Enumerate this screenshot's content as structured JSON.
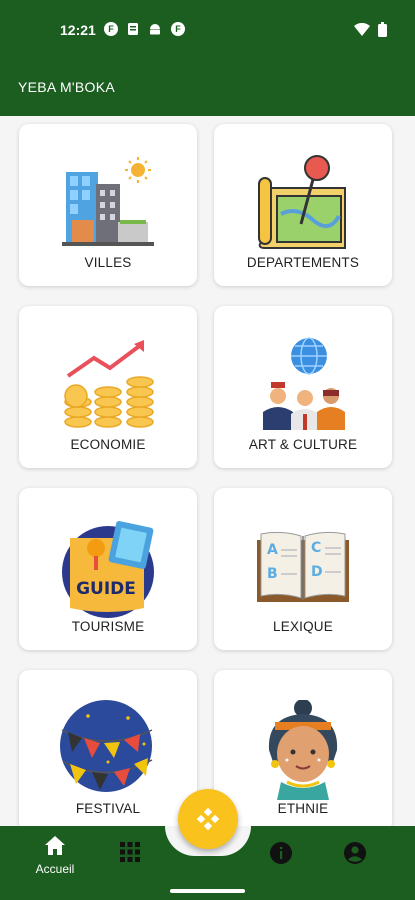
{
  "status_bar": {
    "time": "12:21",
    "notif_icons": [
      "f-circle-icon",
      "document-icon",
      "android-icon",
      "f-circle-icon"
    ],
    "right_icons": [
      "wifi-icon",
      "battery-icon"
    ]
  },
  "app_bar": {
    "title": "YEBA M'BOKA"
  },
  "menu": [
    {
      "label": "VILLES",
      "icon": "city-buildings-icon"
    },
    {
      "label": "DEPARTEMENTS",
      "icon": "map-pin-icon"
    },
    {
      "label": "ECONOMIE",
      "icon": "coins-growth-icon"
    },
    {
      "label": "ART & CULTURE",
      "icon": "people-globe-icon"
    },
    {
      "label": "TOURISME",
      "icon": "guide-book-icon"
    },
    {
      "label": "LEXIQUE",
      "icon": "abc-book-icon"
    },
    {
      "label": "FESTIVAL",
      "icon": "festival-icon"
    },
    {
      "label": "ETHNIE",
      "icon": "ethnic-woman-icon"
    }
  ],
  "bottom_nav": {
    "home_label": "Accueil",
    "items": [
      "home-icon",
      "grid-icon",
      "info-icon",
      "account-icon"
    ]
  },
  "colors": {
    "primary": "#1b5e20",
    "accent": "#f9c21c",
    "background": "#f5f5f5"
  }
}
